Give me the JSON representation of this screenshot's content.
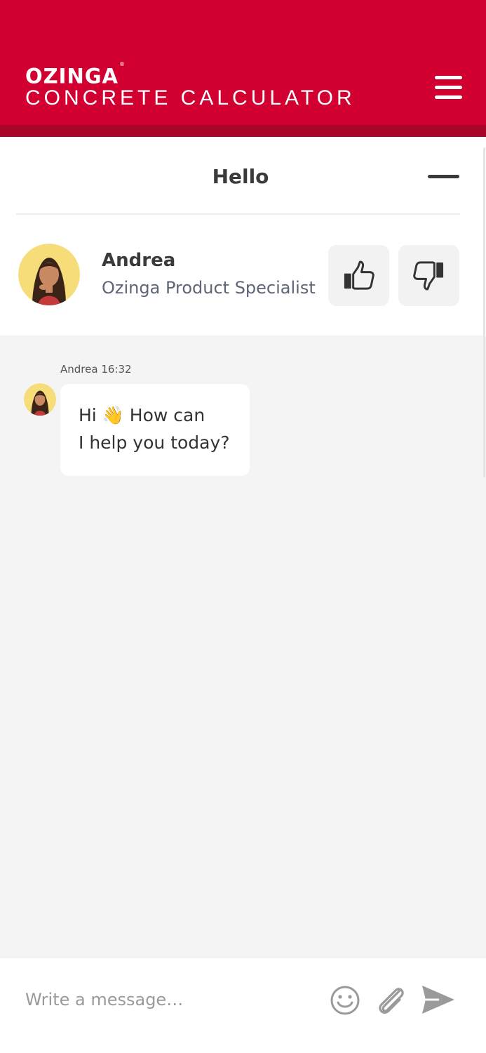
{
  "header": {
    "brand": "OZINGA",
    "brand_mark": "®",
    "app_name": "CONCRETE CALCULATOR",
    "menu_icon": "hamburger-menu-icon"
  },
  "chat_panel": {
    "title": "Hello",
    "minimize_icon": "minimize-icon",
    "agent": {
      "name": "Andrea",
      "role": "Ozinga Product Specialist"
    },
    "rating": {
      "up_icon": "thumbs-up-icon",
      "down_icon": "thumbs-down-icon"
    }
  },
  "messages": [
    {
      "sender": "Andrea",
      "time": "16:32",
      "meta": "Andrea 16:32",
      "line1": "Hi 👋 How can",
      "line2": "I help you today?"
    }
  ],
  "composer": {
    "placeholder": "Write a message…",
    "emoji_icon": "smiley-icon",
    "attach_icon": "paperclip-icon",
    "send_icon": "send-icon"
  },
  "colors": {
    "brand_red": "#d10030",
    "brand_red_dark": "#a8052b",
    "chat_background": "#f4f4f4",
    "text_dark": "#3a3a3a",
    "text_muted": "#5d6677",
    "icon_gray": "#9a9a9a"
  }
}
